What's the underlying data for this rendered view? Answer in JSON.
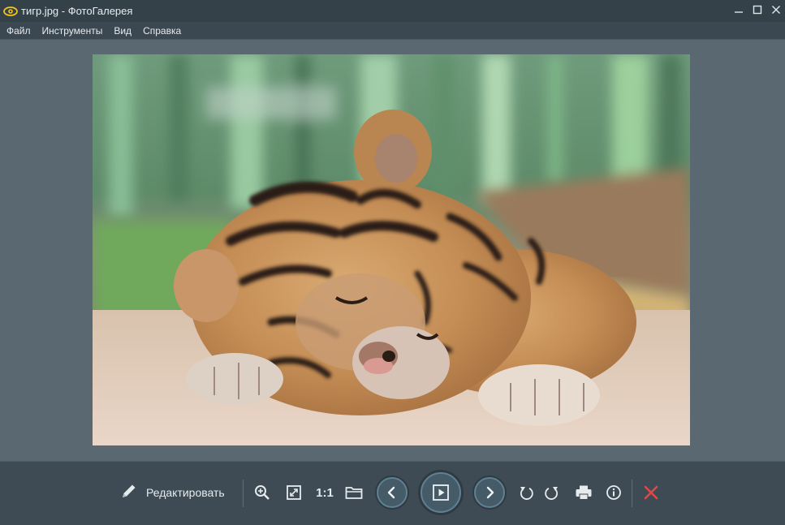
{
  "window": {
    "title": "тигр.jpg - ФотоГалерея",
    "icon": "eye-icon",
    "controls": [
      "minimize-icon",
      "maximize-icon",
      "close-icon"
    ]
  },
  "menu": {
    "items": [
      {
        "label": "Файл"
      },
      {
        "label": "Инструменты"
      },
      {
        "label": "Вид"
      },
      {
        "label": "Справка"
      }
    ]
  },
  "viewer": {
    "photo_subject": "sleeping tiger cub"
  },
  "toolbar": {
    "edit_label": "Редактировать",
    "actual_size_label": "1:1",
    "icons": {
      "edit": "pencil-icon",
      "zoom": "zoom-in-icon",
      "fit": "fit-screen-icon",
      "folder": "folder-icon",
      "prev": "chevron-left-icon",
      "slideshow": "play-icon",
      "next": "chevron-right-icon",
      "rotate_left": "rotate-left-icon",
      "rotate_right": "rotate-right-icon",
      "print": "printer-icon",
      "info": "info-icon",
      "delete": "delete-x-icon"
    }
  },
  "colors": {
    "titlebar": "#354149",
    "menubar": "#3b4851",
    "viewer_bg": "#5a6871",
    "toolbar_bg": "#3e4b54",
    "delete_red": "#e04747",
    "icon_light": "#e6ebee"
  }
}
